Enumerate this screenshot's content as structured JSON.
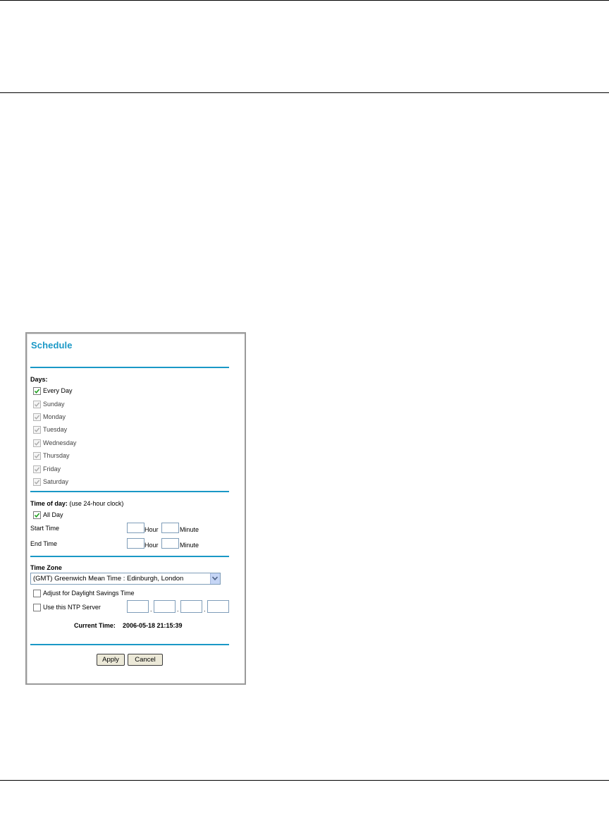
{
  "panel": {
    "title": "Schedule"
  },
  "days": {
    "heading": "Days:",
    "items": [
      {
        "label": "Every Day",
        "checked": true,
        "disabled": false
      },
      {
        "label": "Sunday",
        "checked": true,
        "disabled": true
      },
      {
        "label": "Monday",
        "checked": true,
        "disabled": true
      },
      {
        "label": "Tuesday",
        "checked": true,
        "disabled": true
      },
      {
        "label": "Wednesday",
        "checked": true,
        "disabled": true
      },
      {
        "label": "Thursday",
        "checked": true,
        "disabled": true
      },
      {
        "label": "Friday",
        "checked": true,
        "disabled": true
      },
      {
        "label": "Saturday",
        "checked": true,
        "disabled": true
      }
    ]
  },
  "time_of_day": {
    "heading": "Time of day:",
    "note": "(use 24-hour clock)",
    "all_day": {
      "label": "All Day",
      "checked": true
    },
    "start_label": "Start Time",
    "end_label": "End Time",
    "hour_label": "Hour",
    "minute_label": "Minute",
    "start_hour": "",
    "start_minute": "",
    "end_hour": "",
    "end_minute": ""
  },
  "time_zone": {
    "heading": "Time Zone",
    "selected": "(GMT) Greenwich Mean Time : Edinburgh, London",
    "daylight": {
      "label": "Adjust for Daylight Savings Time",
      "checked": false
    },
    "ntp": {
      "label": "Use this NTP Server",
      "checked": false,
      "octets": [
        "",
        "",
        "",
        ""
      ]
    },
    "current_time_label": "Current Time:",
    "current_time_value": "2006-05-18 21:15:39"
  },
  "buttons": {
    "apply": "Apply",
    "cancel": "Cancel"
  },
  "colors": {
    "accent": "#1a98c6",
    "panel_border": "#9a9a9a",
    "button_face": "#ece9d8"
  }
}
